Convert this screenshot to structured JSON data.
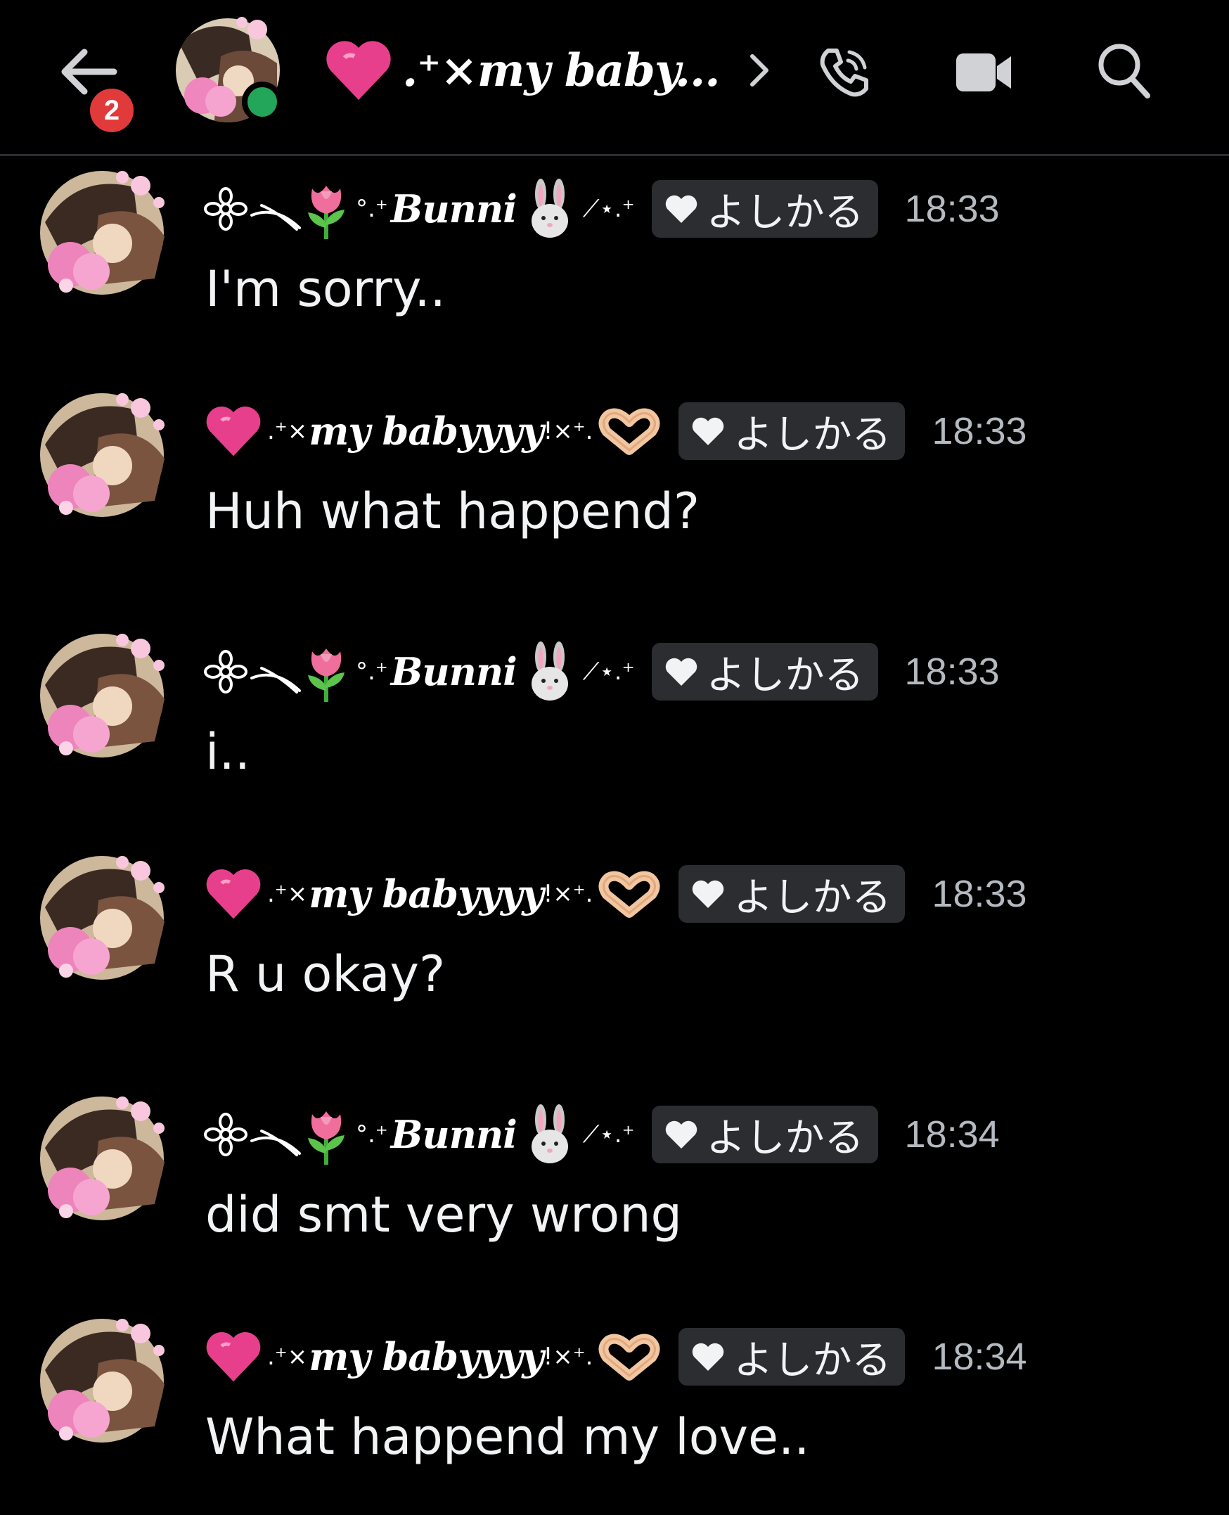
{
  "header": {
    "unread_count": "2",
    "channel_name": ".⁺×my baby...",
    "status": "online",
    "icons": [
      "arrow-left-icon",
      "phone-icon",
      "video-camera-icon",
      "search-icon"
    ]
  },
  "users": {
    "bunni": {
      "display_name": "Bunni",
      "prefix": "❀⟍",
      "suffix": "⟋⋆.⁺"
    },
    "babyyyy": {
      "display_name": "my babyyyy",
      "prefix": ".⁺×",
      "suffix": "!×⁺."
    }
  },
  "tag_label": "よしかる",
  "messages": [
    {
      "author": "bunni",
      "time": "18:33",
      "text": "I'm sorry.."
    },
    {
      "author": "babyyyy",
      "time": "18:33",
      "text": "Huh what happend?"
    },
    {
      "author": "bunni",
      "time": "18:33",
      "text": "i.."
    },
    {
      "author": "babyyyy",
      "time": "18:33",
      "text": "R u okay?"
    },
    {
      "author": "bunni",
      "time": "18:34",
      "text": "did smt very wrong"
    },
    {
      "author": "babyyyy",
      "time": "18:34",
      "text": "What happend my love.."
    }
  ],
  "colors": {
    "background": "#000000",
    "tag_background": "#2b2d31",
    "badge": "#e13a3a",
    "online": "#23a55a",
    "timestamp": "#b5bac1"
  }
}
